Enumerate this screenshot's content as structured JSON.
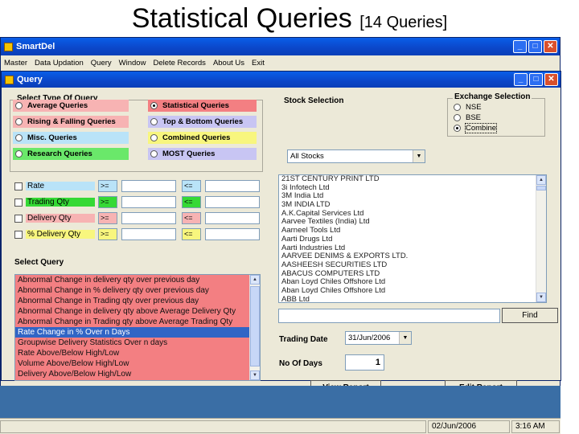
{
  "slide": {
    "title": "Statistical Queries",
    "subtitle": "[14 Queries]"
  },
  "app": {
    "title": "SmartDel",
    "menu": [
      "Master",
      "Data Updation",
      "Query",
      "Window",
      "Delete Records",
      "About Us",
      "Exit"
    ]
  },
  "query_window": {
    "title": "Query",
    "type_group": {
      "label": "Select Type Of Query",
      "options": [
        {
          "label": "Average Queries",
          "color": "#f7b3b3",
          "selected": false
        },
        {
          "label": "Statistical Queries",
          "color": "#f37f82",
          "selected": true
        },
        {
          "label": "Rising & Falling Queries",
          "color": "#f7b3b3",
          "selected": false
        },
        {
          "label": "Top & Bottom Queries",
          "color": "#c8c5f3",
          "selected": false
        },
        {
          "label": "Misc. Queries",
          "color": "#b9e3f8",
          "selected": false
        },
        {
          "label": "Combined Queries",
          "color": "#f8f67e",
          "selected": false
        },
        {
          "label": "Research Queries",
          "color": "#6ae86a",
          "selected": false
        },
        {
          "label": "MOST Queries",
          "color": "#c8c5f3",
          "selected": false
        }
      ]
    },
    "filters": [
      {
        "label": "Rate",
        "color": "#b9e3f8",
        "op1": ">=",
        "op2": "<="
      },
      {
        "label": "Trading Qty",
        "color": "#35d935",
        "op1": ">=",
        "op2": "<="
      },
      {
        "label": "Delivery Qty",
        "color": "#f7b3b3",
        "op1": ">=",
        "op2": "<="
      },
      {
        "label": "% Delivery Qty",
        "color": "#f8f67e",
        "op1": ">=",
        "op2": "<="
      }
    ],
    "select_query": {
      "label": "Select Query",
      "items": [
        "Abnormal Change in delivery qty over previous day",
        "Abnormal Change in % delivery qty over previous day",
        "Abnormal Change in Trading qty over previous day",
        "Abnormal Change in delivery qty above Average Delivery Qty",
        "Abnormal Change in Trading qty above Average Trading Qty",
        "Rate Change in % Over n Days",
        "Groupwise Delivery Statistics Over n days",
        "Rate Above/Below High/Low",
        "Volume Above/Below High/Low",
        "Delivery Above/Below High/Low"
      ],
      "selected_index": 5
    },
    "stock_selection": {
      "label": "Stock Selection",
      "combo_value": "All Stocks",
      "stocks": [
        "21ST CENTURY PRINT LTD",
        "3i Infotech Ltd",
        "3M India Ltd",
        "3M INDIA LTD",
        "A.K.Capital Services Ltd",
        "Aarvee Textiles (India) Ltd",
        "Aarneel Tools Ltd",
        "Aarti Drugs Ltd",
        "Aarti Industries Ltd",
        "AARVEE DENIMS & EXPORTS LTD.",
        "AASHEESH SECURITIES LTD",
        "ABACUS COMPUTERS LTD",
        "Aban Loyd Chiles Offshore Ltd",
        "Aban Loyd Chiles Offshore Ltd",
        "ABB Ltd"
      ]
    },
    "exchange": {
      "label": "Exchange Selection",
      "options": [
        {
          "label": "NSE",
          "selected": false
        },
        {
          "label": "BSE",
          "selected": false
        },
        {
          "label": "Combine",
          "selected": true
        }
      ]
    },
    "find": {
      "value": "",
      "button": "Find"
    },
    "trading_date": {
      "label": "Trading Date",
      "value": "31/Jun/2006"
    },
    "no_of_days": {
      "label": "No Of Days",
      "value": "1"
    },
    "buttons": {
      "view_report": "View Report",
      "edit_report": "Edit Report"
    }
  },
  "status": {
    "date": "02/Jun/2006",
    "time": "3:16 AM"
  }
}
